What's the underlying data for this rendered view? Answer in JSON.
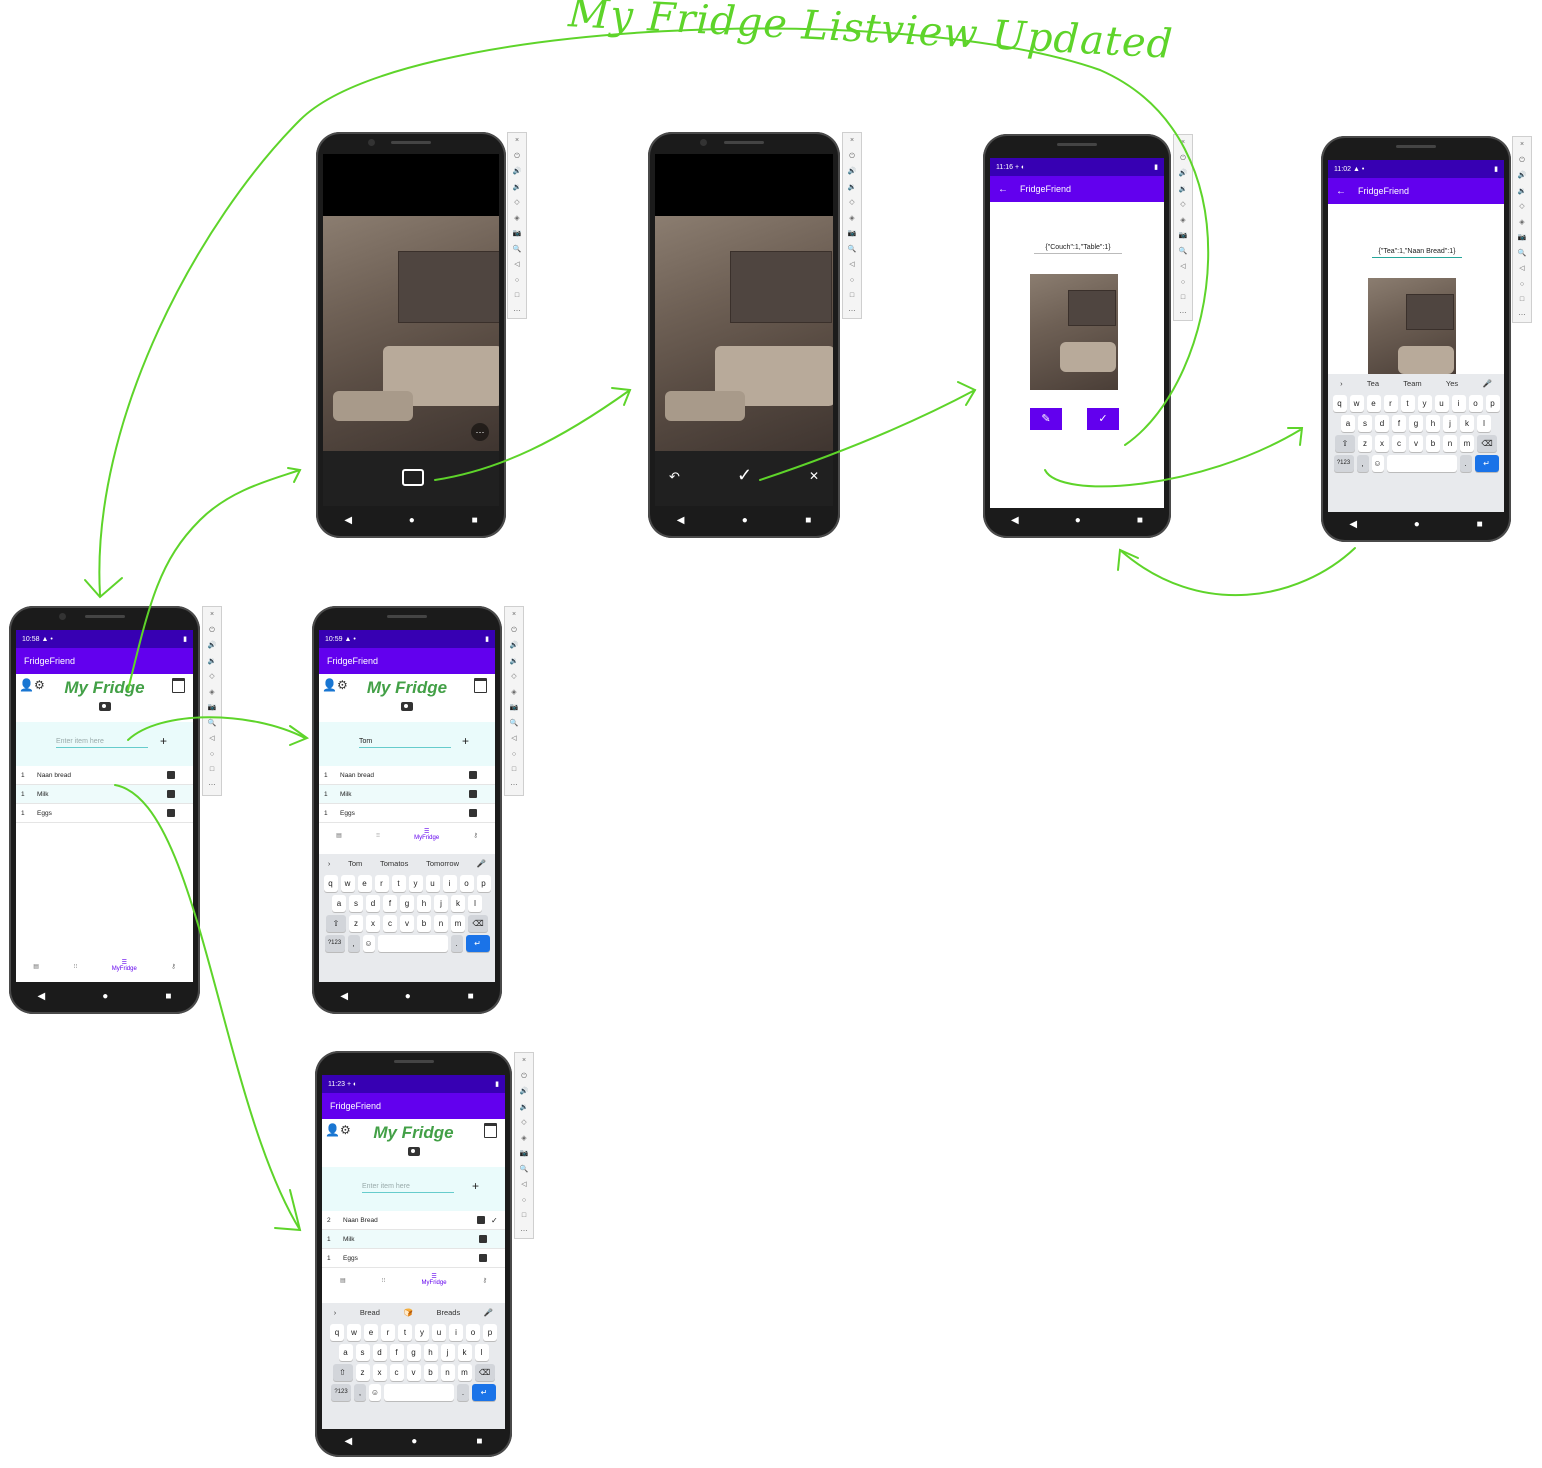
{
  "annotation": {
    "title": "My Fridge Listview Updated"
  },
  "app": {
    "name": "FridgeFriend",
    "heading": "My Fridge"
  },
  "icons": {
    "user_settings": "person-gear-icon",
    "calendar": "calendar-icon",
    "camera": "camera-icon",
    "delete": "trash-icon",
    "check": "check-icon",
    "back": "arrow-back-icon",
    "edit": "pencil-icon",
    "shutter": "camera-shutter-icon",
    "undo": "undo-icon",
    "close": "close-icon"
  },
  "colors": {
    "status_bar": "#3700b3",
    "app_bar": "#6200ee",
    "heading": "#43a047",
    "entry_bg": "#eafbfb",
    "arrows": "#5ed42a",
    "enter_key": "#1a73e8"
  },
  "glyphs": {
    "plus": "+",
    "back": "←",
    "check": "✓",
    "close": "✕",
    "undo": "↶",
    "edit": "✎",
    "dots": "⋯",
    "nav_back": "◀",
    "nav_home": "●",
    "nav_recent": "■",
    "tab_active": "☰"
  },
  "phones": {
    "camera_capture": {},
    "camera_confirm": {},
    "result_default": {
      "time": "11:16",
      "status_icons": "+ ◐",
      "json_text": "{\"Couch\":1,\"Table\":1}"
    },
    "result_editing": {
      "time": "11:02",
      "status_icons": "▲ •",
      "json_text": "{\"Tea\":1,\"Naan Bread\":1}",
      "suggestions": [
        "Tea",
        "Team",
        "Yes"
      ]
    },
    "main_initial": {
      "time": "10:58",
      "status_icons": "▲ •",
      "input_placeholder": "Enter item here",
      "items": [
        {
          "qty": "1",
          "name": "Naan bread"
        },
        {
          "qty": "1",
          "name": "Milk"
        },
        {
          "qty": "1",
          "name": "Eggs"
        }
      ]
    },
    "main_typing": {
      "time": "10:59",
      "status_icons": "▲ •",
      "input_value": "Tom",
      "items": [
        {
          "qty": "1",
          "name": "Naan bread"
        },
        {
          "qty": "1",
          "name": "Milk"
        },
        {
          "qty": "1",
          "name": "Eggs"
        }
      ],
      "suggestions": [
        "Tom",
        "Tomatos",
        "Tomorrow"
      ]
    },
    "main_updated": {
      "time": "11:23",
      "status_icons": "+ ◐",
      "input_placeholder": "Enter item here",
      "items": [
        {
          "qty": "2",
          "name": "Naan Bread"
        },
        {
          "qty": "1",
          "name": "Milk"
        },
        {
          "qty": "1",
          "name": "Eggs"
        }
      ],
      "suggestions": [
        "Bread",
        "🍞",
        "Breads"
      ]
    }
  },
  "bottom_nav": {
    "active_label": "MyFridge"
  },
  "keyboard": {
    "row1": [
      "q",
      "w",
      "e",
      "r",
      "t",
      "y",
      "u",
      "i",
      "o",
      "p"
    ],
    "row2": [
      "a",
      "s",
      "d",
      "f",
      "g",
      "h",
      "j",
      "k",
      "l"
    ],
    "row3": [
      "z",
      "x",
      "c",
      "v",
      "b",
      "n",
      "m"
    ],
    "shift": "⇧",
    "backspace": "⌫",
    "symbols": "?123",
    "comma": ",",
    "emoji": "☺",
    "period": ".",
    "enter": "↵",
    "more": "›",
    "mic": "🎤"
  },
  "emulator_toolbar": [
    "×",
    "⏻",
    "🔊",
    "🔉",
    "◇",
    "◈",
    "📷",
    "🔍",
    "◁",
    "○",
    "□",
    "⋯"
  ]
}
